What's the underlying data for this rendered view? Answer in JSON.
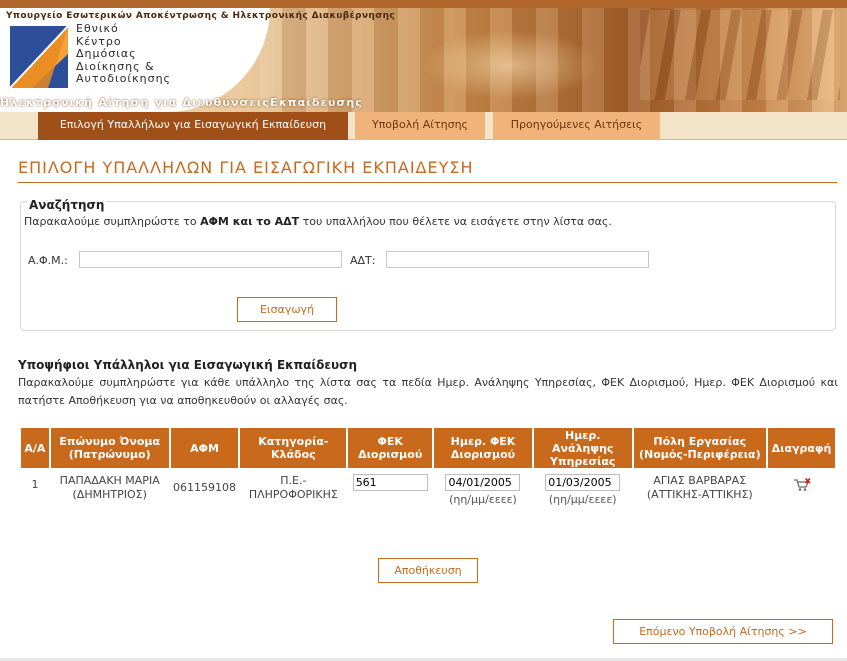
{
  "header": {
    "ministry": "Υπουργείο Εσωτερικών Αποκέντρωσης & Ηλεκτρονικής Διακυβέρνησης",
    "org_lines": [
      "Εθνικό",
      "Κέντρο",
      "Δημόσιας",
      "Διοίκησης &",
      "Αυτοδιοίκησης"
    ],
    "app_title": "Ηλεκτρονική Αίτηση για ΔιευθύνσειςΕκπαίδευσης"
  },
  "tabs": [
    {
      "label": "Επιλογή Υπαλλήλων για Εισαγωγική Εκπαίδευση",
      "active": true
    },
    {
      "label": "Υποβολή Αίτησης",
      "active": false
    },
    {
      "label": "Προηγούμενες Αιτήσεις",
      "active": false
    }
  ],
  "page_title": "ΕΠΙΛΟΓΗ ΥΠΑΛΛΗΛΩΝ ΓΙΑ ΕΙΣΑΓΩΓΙΚΗ ΕΚΠΑΙΔΕΥΣΗ",
  "search": {
    "title": "Αναζήτηση",
    "help_pre": "Παρακαλούμε συμπληρώστε το ",
    "help_bold": "ΑΦΜ και το ΑΔΤ",
    "help_post": " του υπαλλήλου που θέλετε να εισάγετε στην λίστα σας.",
    "afm_label": "Α.Φ.Μ.:",
    "afm_value": "",
    "adt_label": "ΑΔΤ:",
    "adt_value": "",
    "insert_label": "Εισαγωγή"
  },
  "candidates": {
    "title": "Υποψήφιοι Υπάλληλοι για Εισαγωγική Εκπαίδευση",
    "help": "Παρακαλούμε συμπληρώστε για κάθε υπάλληλο της λίστα σας τα πεδία Ημερ. Ανάληψης Υπηρεσίας, ΦΕΚ Διορισμού, Ημερ. ΦΕΚ Διορισμού και πατήστε Αποθήκευση για να αποθηκευθούν οι αλλαγές σας.",
    "columns": [
      "Α/Α",
      "Επώνυμο Όνομα (Πατρώνυμο)",
      "ΑΦΜ",
      "Κατηγορία-Κλάδος",
      "ΦΕΚ Διορισμού",
      "Ημερ. ΦΕΚ Διορισμού",
      "Ημερ. Ανάληψης Υπηρεσίας",
      "Πόλη Εργασίας (Νομός-Περιφέρεια)",
      "Διαγραφή"
    ],
    "rows": [
      {
        "aa": "1",
        "name": "ΠΑΠΑΔΑΚΗ ΜΑΡΙΑ",
        "father": "(ΔΗΜΗΤΡΙΟΣ)",
        "afm": "061159108",
        "category": "Π.Ε.-",
        "branch": "ΠΛΗΡΟΦΟΡΙΚΗΣ",
        "fek": "561",
        "fek_date": "04/01/2005",
        "fek_date_hint": "(ηη/μμ/εεεε)",
        "start_date": "01/03/2005",
        "start_date_hint": "(ηη/μμ/εεεε)",
        "city": "ΑΓΙΑΣ ΒΑΡΒΑΡΑΣ",
        "region": "(ΑΤΤΙΚΗΣ-ΑΤΤΙΚΗΣ)",
        "delete_icon": "cart-remove-icon"
      }
    ],
    "save_label": "Αποθήκευση"
  },
  "next_label": "Επόμενο Υποβολή Αίτησης >>",
  "colors": {
    "accent": "#c8691c",
    "active_tab": "#a14f18",
    "inactive_tab": "#f0b37a"
  }
}
